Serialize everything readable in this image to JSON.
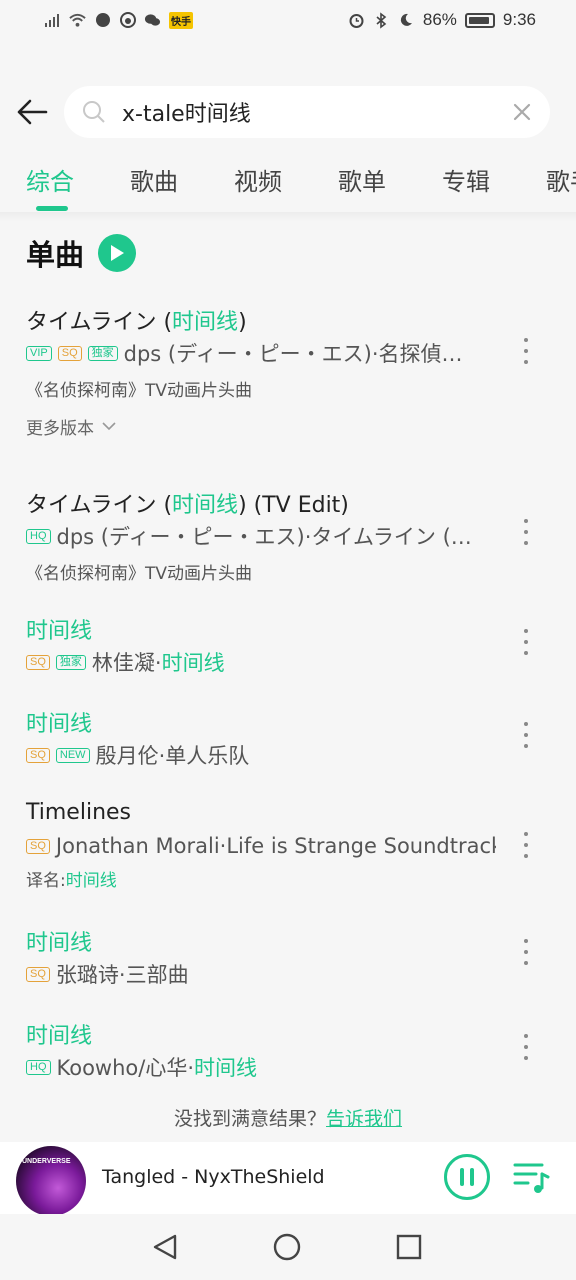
{
  "status_bar": {
    "battery": "86%",
    "time": "9:36",
    "notif_badge": "快手"
  },
  "search": {
    "query": "x-tale时间线"
  },
  "tabs": [
    {
      "label": "综合",
      "active": true
    },
    {
      "label": "歌曲"
    },
    {
      "label": "视频"
    },
    {
      "label": "歌单"
    },
    {
      "label": "专辑"
    },
    {
      "label": "歌手"
    }
  ],
  "section": {
    "title": "单曲"
  },
  "songs": [
    {
      "title_pre": "タイムライン (",
      "title_hl": "时间线",
      "title_post": ")",
      "tags": [
        "VIP",
        "SQ",
        "独家"
      ],
      "artist": "dps (ディー・ピー・エス)·名探偵…",
      "sub": "《名侦探柯南》TV动画片头曲"
    },
    {
      "title_pre": "タイムライン (",
      "title_hl": "时间线",
      "title_post": ") (TV Edit)",
      "tags": [
        "HQ"
      ],
      "artist": "dps (ディー・ピー・エス)·タイムライン (…",
      "sub": "《名侦探柯南》TV动画片头曲"
    },
    {
      "title": "时间线",
      "tags": [
        "SQ",
        "独家"
      ],
      "artist_pre": "林佳凝·",
      "artist_hl": "时间线"
    },
    {
      "title": "时间线",
      "tags": [
        "SQ",
        "NEW"
      ],
      "artist": "殷月伦·单人乐队"
    },
    {
      "title": "Timelines",
      "tags": [
        "SQ"
      ],
      "artist": "Jonathan Morali·Life is Strange Soundtrack",
      "sub_pre": "译名:",
      "sub_hl": "时间线"
    },
    {
      "title": "时间线",
      "tags": [
        "SQ"
      ],
      "artist": "张璐诗·三部曲"
    },
    {
      "title": "时间线",
      "tags": [
        "HQ"
      ],
      "artist_pre": "Koowho/心华·",
      "artist_hl": "时间线"
    }
  ],
  "more_versions": "更多版本",
  "feedback": {
    "text": "没找到满意结果？",
    "link": "告诉我们"
  },
  "player": {
    "now_playing": "Tangled - NyxTheShield",
    "cover_text": "UNDERVERSE"
  },
  "colors": {
    "accent": "#1fc78d",
    "sq_tag": "#e4a23a",
    "background": "#f6f6f6"
  }
}
